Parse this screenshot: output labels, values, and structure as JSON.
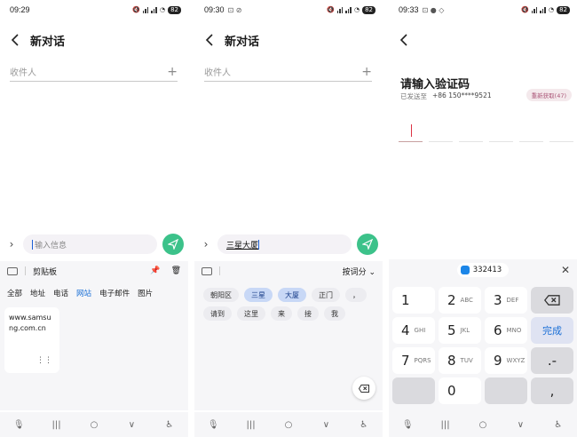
{
  "screen1": {
    "time": "09:29",
    "battery": "82",
    "title": "新对话",
    "recipient_placeholder": "收件人",
    "message_placeholder": "输入信息",
    "clipboard_title": "剪贴板",
    "clip_tabs": [
      "全部",
      "地址",
      "电话",
      "网站",
      "电子邮件",
      "图片"
    ],
    "active_tab": "网站",
    "clip_item": "www.samsung.com.cn"
  },
  "screen2": {
    "time": "09:30",
    "battery": "82",
    "title": "新对话",
    "recipient_placeholder": "收件人",
    "message_text": "三星大厦",
    "input_mode": "按词分",
    "suggestions_row1": [
      "朝阳区",
      "三星",
      "大厦",
      "正门",
      "，"
    ],
    "suggestions_row2": [
      "请到",
      "这里",
      "来",
      "接",
      "我"
    ]
  },
  "screen3": {
    "time": "09:33",
    "battery": "82",
    "title": "请输入验证码",
    "sent_to_label": "已发送至",
    "phone": "+86 150****9521",
    "resend": "重新获取(47)",
    "paste_code": "332413",
    "keys": [
      {
        "num": "1",
        "sub": ""
      },
      {
        "num": "2",
        "sub": "ABC"
      },
      {
        "num": "3",
        "sub": "DEF"
      },
      {
        "num": "4",
        "sub": "GHI"
      },
      {
        "num": "5",
        "sub": "JKL"
      },
      {
        "num": "6",
        "sub": "MNO"
      },
      {
        "num": "7",
        "sub": "PQRS"
      },
      {
        "num": "8",
        "sub": "TUV"
      },
      {
        "num": "9",
        "sub": "WXYZ"
      },
      {
        "num": "0",
        "sub": ""
      }
    ],
    "done_label": "完成",
    "dot_key": ".-",
    "comma_key": ","
  },
  "colors": {
    "send_green": "#3cc28a",
    "accent_blue": "#1a6fd6"
  }
}
